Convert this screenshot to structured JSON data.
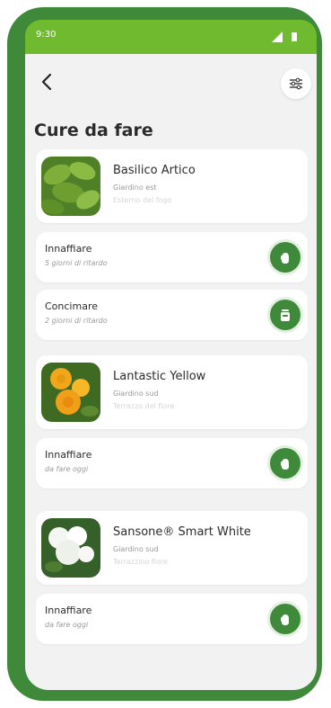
{
  "status_bar": {
    "time": "9:30"
  },
  "header": {
    "title": "Cure da fare"
  },
  "plants": [
    {
      "name": "Basilico Artico",
      "garden": "Giardino est",
      "extra": "Esterno del fogo",
      "image_icon": "basil-plant-photo",
      "tasks": [
        {
          "name": "Innaffiare",
          "note": "5 giorni di ritardo",
          "icon": "watering-hand-icon"
        },
        {
          "name": "Concimare",
          "note": "2 giorni di ritardo",
          "icon": "fertilizer-icon"
        }
      ]
    },
    {
      "name": "Lantastic Yellow",
      "garden": "Giardino sud",
      "extra": "Terrazzo del fiore",
      "image_icon": "lantana-yellow-photo",
      "tasks": [
        {
          "name": "Innaffiare",
          "note": "da fare oggi",
          "icon": "watering-hand-icon"
        }
      ]
    },
    {
      "name": "Sansone® Smart White",
      "garden": "Giardino sud",
      "extra": "Terrazzino fiore",
      "image_icon": "white-flower-photo",
      "tasks": [
        {
          "name": "Innaffiare",
          "note": "da fare oggi",
          "icon": "watering-hand-icon"
        }
      ]
    }
  ],
  "colors": {
    "accent": "#3f8a3a",
    "status_bar": "#6fba2e",
    "background": "#f2f2f2"
  }
}
